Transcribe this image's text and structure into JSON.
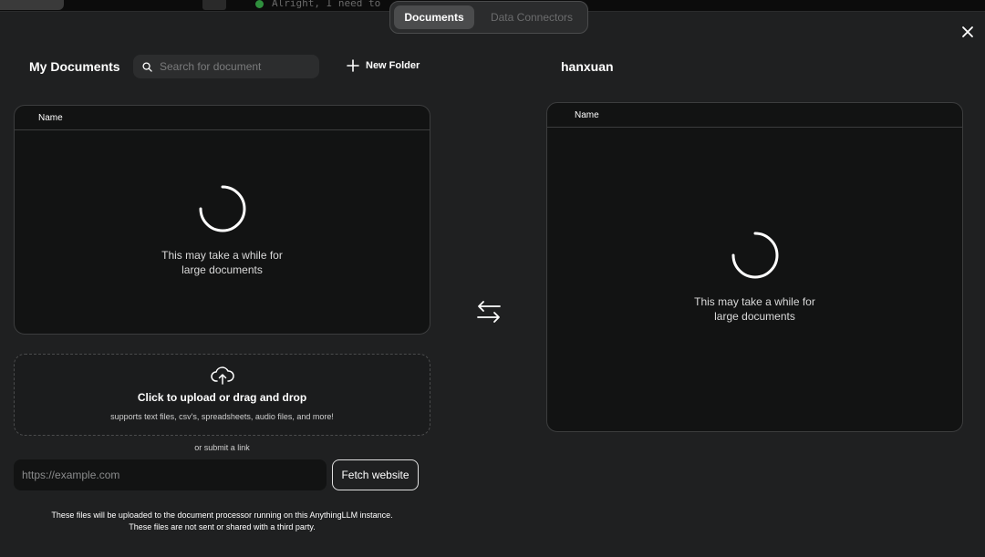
{
  "background": {
    "code_text": "Alright, I need to"
  },
  "tabs": [
    {
      "label": "Documents",
      "active": true
    },
    {
      "label": "Data Connectors",
      "active": false
    }
  ],
  "left": {
    "title": "My Documents",
    "search_placeholder": "Search for document",
    "new_folder_label": "New Folder",
    "table_header": "Name",
    "loading_line1": "This may take a while for",
    "loading_line2": "large documents"
  },
  "right": {
    "title": "hanxuan",
    "table_header": "Name",
    "loading_line1": "This may take a while for",
    "loading_line2": "large documents"
  },
  "upload": {
    "title": "Click to upload or drag and drop",
    "subtitle": "supports text files, csv's, spreadsheets, audio files, and more!"
  },
  "link": {
    "or_text": "or submit a link",
    "url_placeholder": "https://example.com",
    "fetch_label": "Fetch website"
  },
  "footnote": {
    "line1": "These files will be uploaded to the document processor running on this AnythingLLM instance.",
    "line2": "These files are not sent or shared with a third party."
  },
  "icons": [
    "search-icon",
    "plus-icon",
    "close-icon",
    "spinner-icon",
    "swap-arrows-icon",
    "cloud-upload-icon"
  ],
  "colors": {
    "modal_bg": "#1f2021",
    "panel_bg": "#121313",
    "accent": "#ffffff"
  }
}
